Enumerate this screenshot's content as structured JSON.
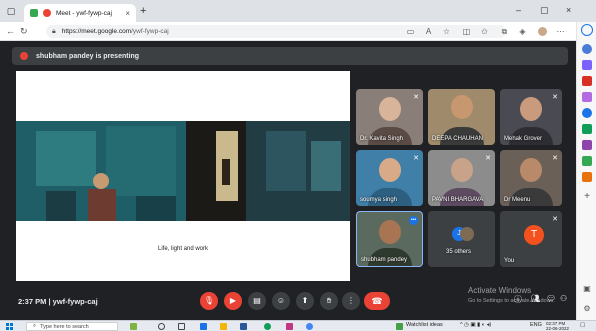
{
  "browser": {
    "tab_title": "Meet - ywf-fywp-caj",
    "tab_close": "×",
    "new_tab": "+",
    "url_host": "https://meet.google.com",
    "url_path": "/ywf-fywp-caj",
    "window_controls": [
      "–",
      "▢",
      "×"
    ]
  },
  "meet": {
    "presenting_banner": "shubham pandey is presenting",
    "slide_caption": "Life, light and work",
    "participants": [
      {
        "name": "Dr. Kavita Singh",
        "muted": true
      },
      {
        "name": "DEEPA CHAUHAN",
        "muted": false
      },
      {
        "name": "Mehak Grover",
        "muted": true
      },
      {
        "name": "soumya singh",
        "muted": true
      },
      {
        "name": "PAVNI BHARGAVA",
        "muted": true
      },
      {
        "name": "Dr Meenu",
        "muted": true
      },
      {
        "name": "shubham pandey",
        "muted": false
      }
    ],
    "others_label": "35 others",
    "others_avatar_initial": "J",
    "you_label": "You",
    "you_initial": "T",
    "clock": "2:37 PM",
    "meeting_code": "ywf-fywp-caj",
    "clock_separator": "|"
  },
  "windows": {
    "activate_title": "Activate Windows",
    "activate_sub": "Go to Settings to activate Windows.",
    "search_placeholder": "Type here to search",
    "tray_label": "Watchlist ideas",
    "tray_lang": "ENG",
    "tray_time": "02:37 PM",
    "tray_date": "22-06-2022"
  },
  "colors": {
    "meet_bg": "#202124",
    "tile_bg": "#3c4043",
    "accent_red": "#ea4335",
    "accent_blue": "#1a73e8"
  }
}
